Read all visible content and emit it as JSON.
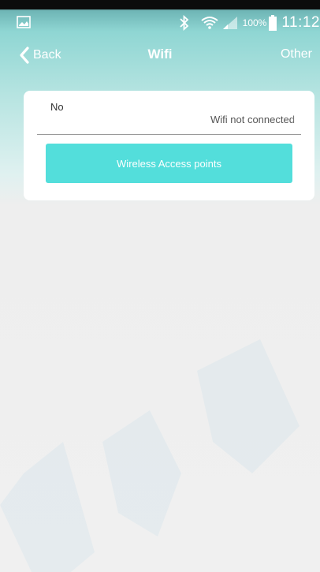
{
  "status_bar": {
    "battery_text": "100%",
    "time": "11:12",
    "icons": [
      "image-icon",
      "bluetooth-icon",
      "wifi-icon",
      "signal-icon",
      "battery-icon"
    ]
  },
  "nav": {
    "back_label": "Back",
    "title": "Wifi",
    "other_label": "Other"
  },
  "wifi_card": {
    "network_name": "No",
    "status_text": "Wifi not connected",
    "access_points_button": "Wireless Access points"
  },
  "colors": {
    "accent": "#53dedb",
    "header_teal": "#8fd6d3",
    "background": "#f0f0f0",
    "card": "#ffffff"
  }
}
